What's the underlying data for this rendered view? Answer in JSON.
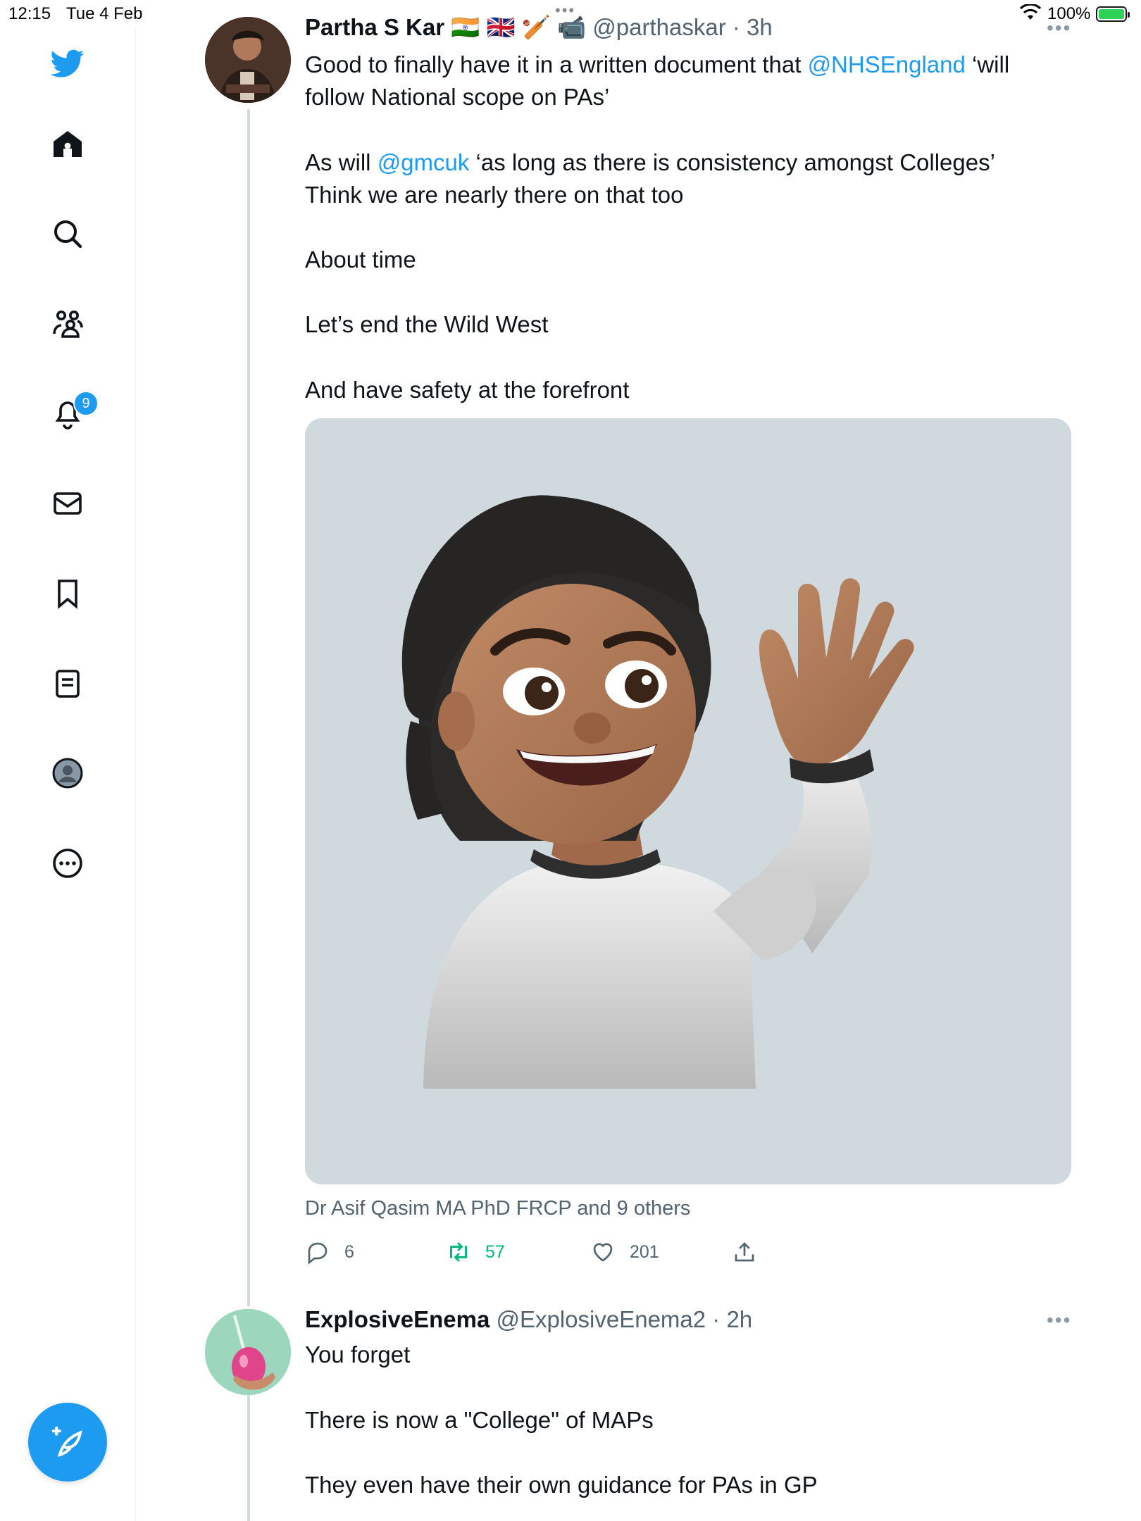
{
  "status_bar": {
    "time": "12:15",
    "date": "Tue 4 Feb",
    "battery": "100%"
  },
  "sidebar": {
    "items": [
      "home-icon",
      "search-icon",
      "communities-icon",
      "notifications-icon",
      "messages-icon",
      "bookmarks-icon",
      "lists-icon",
      "profile-icon",
      "more-icon"
    ],
    "notification_count": "9"
  },
  "tweet1": {
    "name": "Partha S Kar 🇮🇳 🇬🇧 🏏 📹",
    "handle": "@parthaskar",
    "time": "· 3h",
    "line1_pre": "Good to finally have it in a written document that ",
    "mention1": "@NHSEngland",
    "line1_post": " ‘will",
    "line2": "follow National scope on PAs’",
    "line3_pre": "As will ",
    "mention2": "@gmcuk",
    "line3_post": " ‘as long as there is consistency amongst Colleges’",
    "line4": "Think we are nearly there on that too",
    "line5": "About time",
    "line6": "Let’s end the Wild West",
    "line7": "And have safety at the forefront",
    "liked_by": "Dr Asif Qasim MA PhD FRCP and 9 others",
    "replies": "6",
    "retweets": "57",
    "likes": "201"
  },
  "tweet2": {
    "name": "ExplosiveEnema",
    "handle": "@ExplosiveEnema2",
    "time": "· 2h",
    "line1": "You forget",
    "line2": "There is now a \"College\" of MAPs",
    "line3": "They even have their own guidance for PAs in GP"
  },
  "colors": {
    "accent": "#1d9bf0",
    "retweet": "#00ba7c",
    "secondary_text": "#536471"
  }
}
